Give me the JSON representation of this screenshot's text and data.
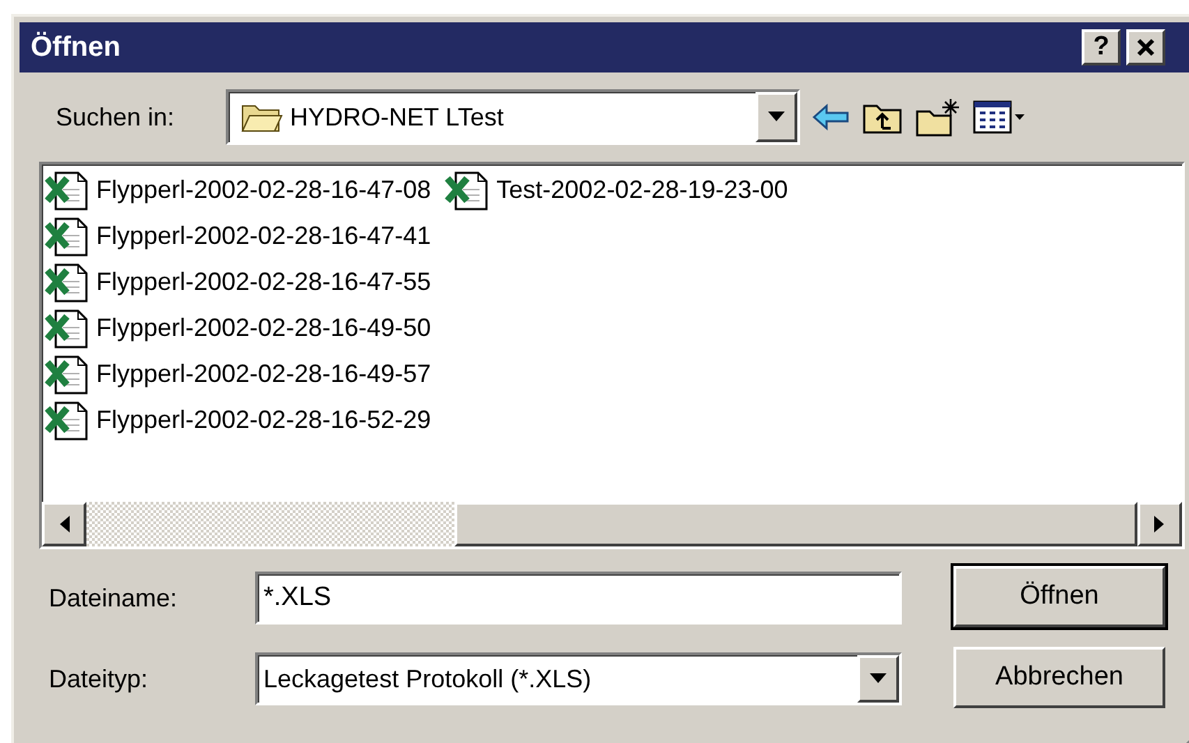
{
  "window": {
    "title": "Öffnen",
    "help_label": "?"
  },
  "look_in": {
    "label": "Suchen in:",
    "value": "HYDRO-NET LTest"
  },
  "files": [
    {
      "name": "Flypperl-2002-02-28-16-47-08"
    },
    {
      "name": "Flypperl-2002-02-28-16-47-41"
    },
    {
      "name": "Flypperl-2002-02-28-16-47-55"
    },
    {
      "name": "Flypperl-2002-02-28-16-49-50"
    },
    {
      "name": "Flypperl-2002-02-28-16-49-57"
    },
    {
      "name": "Flypperl-2002-02-28-16-52-29"
    },
    {
      "name": "Test-2002-02-28-19-23-00"
    }
  ],
  "file_name": {
    "label": "Dateiname:",
    "value": "*.XLS"
  },
  "file_type": {
    "label": "Dateityp:",
    "value": "Leckagetest Protokoll (*.XLS)"
  },
  "buttons": [
    {
      "label": "Öffnen",
      "default": true
    },
    {
      "label": "Abbrechen",
      "default": false
    }
  ]
}
